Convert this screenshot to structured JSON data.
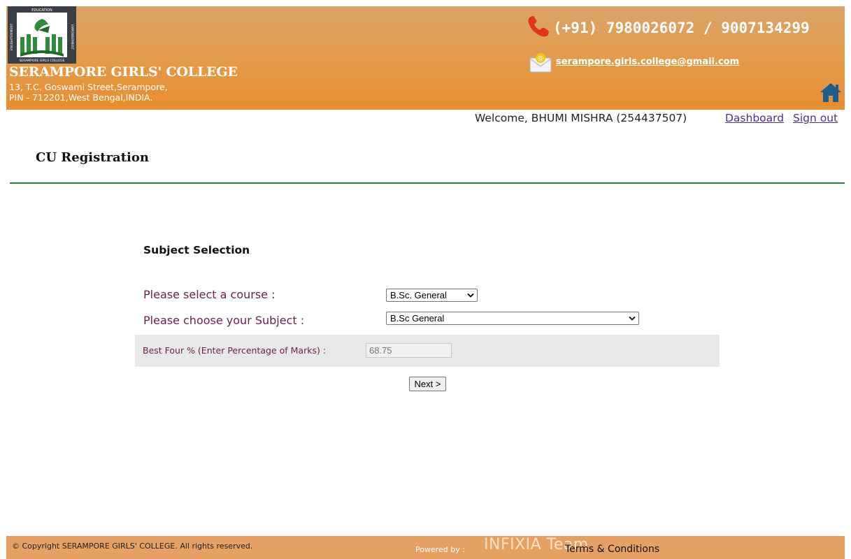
{
  "header": {
    "college_name": "SERAMPORE GIRLS' COLLEGE",
    "address_line1": "13, T.C. Goswami Street,Serampore,",
    "address_line2": "PIN - 712201,West Bengal,INDIA.",
    "phone": "(+91) 7980026072 / 9007134299",
    "email": "serampore.girls.college@gmail.com",
    "logo_text": {
      "top": "EDUCATION",
      "left": "ENLIGHTENMENT",
      "right": "EMPOWERMENT",
      "bottom": "SERAMPORE GIRLS COLLEGE"
    }
  },
  "user_bar": {
    "welcome": "Welcome, BHUMI MISHRA (254437507)",
    "dashboard_link": "Dashboard",
    "signout_link": "Sign out"
  },
  "page_title": "CU Registration",
  "form": {
    "section_title": "Subject Selection",
    "course_label": "Please select a course :",
    "course_value": "B.Sc. General",
    "subject_label": "Please choose your Subject :",
    "subject_value": "B.Sc General",
    "marks_label": "Best Four % (Enter Percentage of Marks) :",
    "marks_value": "68.75",
    "next_button": "Next >"
  },
  "footer": {
    "copyright": "© Copyright SERAMPORE GIRLS' COLLEGE. All rights reserved.",
    "powered_label": "Powered by :",
    "powered_team": "INFIXIA Team",
    "terms": "Terms & Conditions"
  },
  "colors": {
    "header_orange": "#e49a48",
    "footer_orange": "#e6a064",
    "label_maroon": "#6b1f4e",
    "rule_green": "#2e7d32",
    "link_purple": "#4e2f8f",
    "home_icon_blue": "#1d5f8a"
  },
  "icons": [
    "logo-icon",
    "phone-icon",
    "mail-icon",
    "home-icon",
    "chevron-down-icon"
  ]
}
